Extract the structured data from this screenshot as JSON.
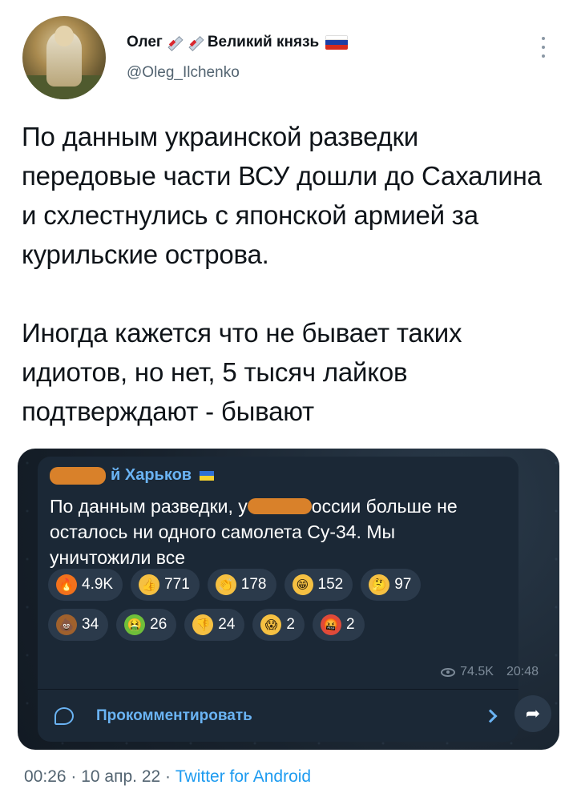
{
  "author": {
    "name_prefix": "Олег",
    "name_suffix": "Великий князь",
    "handle": "@Oleg_Ilchenko",
    "flag_colors": [
      "#ffffff",
      "#1c3fa6",
      "#d52b1e"
    ]
  },
  "tweet": {
    "text": "По данным украинской разведки передовые части ВСУ дошли до Сахалина и схлестнулись с японской армией за курильские острова.\n\nИногда кажется что не бывает таких идиотов, но нет, 5 тысяч лайков подтверждают - бывают"
  },
  "embedded_post": {
    "channel_name_visible": "й Харьков",
    "message_part1": "По данным разведки, у",
    "message_part2": "оссии больше не осталось ни одного самолета Су-34. Мы уничтожили все",
    "reactions_row1": [
      {
        "emoji": "fire-icon",
        "count": "4.9K",
        "color": "#f2711c",
        "glyph": "🔥"
      },
      {
        "emoji": "thumbs-up-icon",
        "count": "771",
        "color": "#f5c042",
        "glyph": "👍"
      },
      {
        "emoji": "clap-icon",
        "count": "178",
        "color": "#f5c042",
        "glyph": "👏"
      },
      {
        "emoji": "grin-icon",
        "count": "152",
        "color": "#f5c042",
        "glyph": "😁"
      },
      {
        "emoji": "thinking-icon",
        "count": "97",
        "color": "#f5c042",
        "glyph": "🤔"
      }
    ],
    "reactions_row2": [
      {
        "emoji": "poop-icon",
        "count": "34",
        "color": "#a0612d",
        "glyph": "💩"
      },
      {
        "emoji": "vomit-icon",
        "count": "26",
        "color": "#6fbf3a",
        "glyph": "🤮"
      },
      {
        "emoji": "thumbs-down-icon",
        "count": "24",
        "color": "#f5c042",
        "glyph": "👎"
      },
      {
        "emoji": "scream-icon",
        "count": "2",
        "color": "#f5c042",
        "glyph": "😱"
      },
      {
        "emoji": "cursing-icon",
        "count": "2",
        "color": "#e04a3a",
        "glyph": "🤬"
      }
    ],
    "views": "74.5K",
    "time": "20:48",
    "comment_label": "Прокомментировать"
  },
  "meta": {
    "time": "00:26",
    "date": "10 апр. 22",
    "source": "Twitter for Android",
    "separator": " · "
  }
}
